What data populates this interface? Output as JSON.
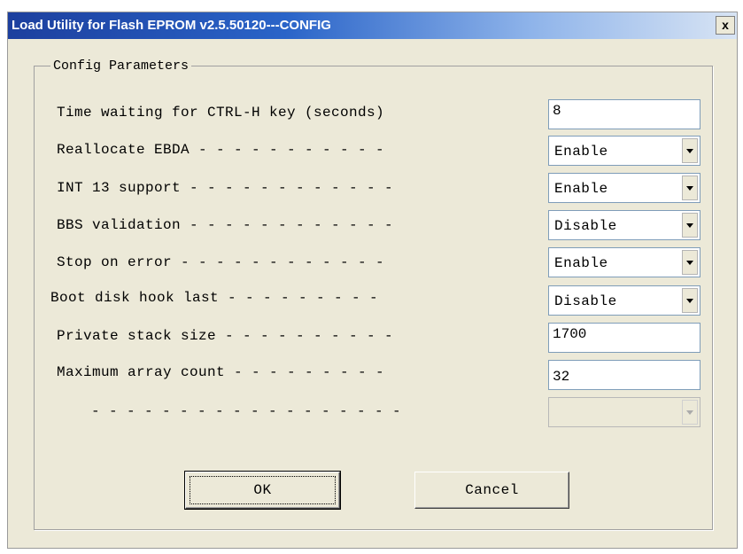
{
  "window": {
    "title": "Load Utility for Flash EPROM v2.5.50120---CONFIG",
    "close_label": "x"
  },
  "group": {
    "title": "Config Parameters"
  },
  "params": [
    {
      "label": "Time waiting for CTRL-H key (seconds)",
      "kind": "text",
      "value": "8"
    },
    {
      "label": "Reallocate EBDA - - - - - - - - - - -",
      "kind": "combo",
      "value": "Enable"
    },
    {
      "label": "INT 13 support - - - - - - - - - - - -",
      "kind": "combo",
      "value": "Enable"
    },
    {
      "label": "BBS validation - - - - - - - - - - - -",
      "kind": "combo",
      "value": "Disable"
    },
    {
      "label": "Stop on error - - - - - - - - - - - -",
      "kind": "combo",
      "value": "Enable"
    },
    {
      "label": "Boot disk hook last - - - - - - - - -",
      "kind": "combo",
      "value": "Disable"
    },
    {
      "label": "Private stack size - - - - - - - - - -",
      "kind": "text",
      "value": "1700"
    },
    {
      "label": "Maximum array count - - - - - - - - -",
      "kind": "text",
      "value": "32"
    },
    {
      "label": "- - - - - - - - - - - - - - - - - -",
      "kind": "combo-disabled",
      "value": ""
    }
  ],
  "buttons": {
    "ok": "OK",
    "cancel": "Cancel"
  }
}
